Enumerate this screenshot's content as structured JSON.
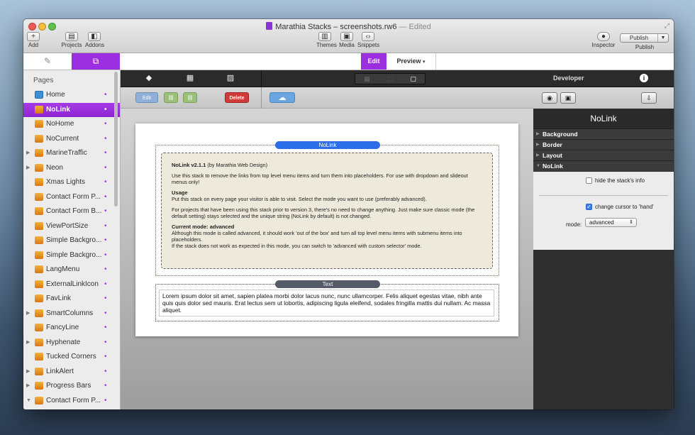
{
  "window": {
    "title": "Marathia Stacks – screenshots.rw6",
    "edited": "— Edited",
    "colors": {
      "accent": "#9b2fe0",
      "link_blue": "#3070e0",
      "delete_red": "#d23a3a"
    }
  },
  "toolbar": {
    "add": "Add",
    "projects": "Projects",
    "addons": "Addons",
    "themes": "Themes",
    "media": "Media",
    "snippets": "Snippets",
    "inspector": "Inspector",
    "publish_btn": "Publish",
    "publish": "Publish"
  },
  "tabs": {
    "edit": "Edit",
    "preview": "Preview"
  },
  "sidebar": {
    "header": "Pages",
    "items": [
      {
        "label": "Home",
        "icon": "home-icon"
      },
      {
        "label": "NoLink",
        "selected": true
      },
      {
        "label": "NoHome"
      },
      {
        "label": "NoCurrent"
      },
      {
        "label": "MarineTraffic",
        "expandable": true
      },
      {
        "label": "Neon",
        "expandable": true
      },
      {
        "label": "Xmas Lights"
      },
      {
        "label": "Contact Form P..."
      },
      {
        "label": "Contact Form B..."
      },
      {
        "label": "ViewPortSize"
      },
      {
        "label": "Simple Backgro..."
      },
      {
        "label": "Simple Backgro..."
      },
      {
        "label": "LangMenu"
      },
      {
        "label": "ExternalLinkIcon"
      },
      {
        "label": "FavLink"
      },
      {
        "label": "SmartColumns",
        "expandable": true
      },
      {
        "label": "FancyLine"
      },
      {
        "label": "Hyphenate",
        "expandable": true
      },
      {
        "label": "Tucked Corners"
      },
      {
        "label": "LinkAlert",
        "expandable": true
      },
      {
        "label": "Progress Bars",
        "expandable": true
      },
      {
        "label": "Contact Form P...",
        "expandable": true,
        "expanded": true
      }
    ]
  },
  "editor": {
    "edit_btn": "Edit",
    "delete_btn": "Delete",
    "stack1_title": "NoLink",
    "stack2_title": "Text",
    "info": {
      "heading": "NoLink v2.1.1",
      "byline": "(by Marathia Web Design)",
      "intro": "Use this stack to remove the links from top level menu items and turn them into placeholders. For use with dropdown and slideout menus only!",
      "usage_title": "Usage",
      "usage": "Put this stack on every page your visitor is able to visit. Select the mode you want to use (preferably advanced).",
      "prior": "For projects that have been using this stack prior to version 3, there's no need to change anything. Just make sure classic mode (the default setting) stays selected and the unique string (NoLink by default) is not changed.",
      "mode_title": "Current mode: advanced",
      "mode_desc": "Although this mode is called advanced, it should work 'out of the box' and turn all top level menu items with submenu items into placeholders.",
      "mode_note": "If the stack does not work as expected in this mode, you can switch to 'advanced with custom selector' mode."
    },
    "lorem": "Lorem ipsum dolor sit amet, sapien platea morbi dolor lacus nunc, nunc ullamcorper. Felis aliquet egestas vitae, nibh ante quis quis dolor sed mauris. Erat lectus sem ut lobortis, adipiscing ligula eleifend, sodales fringilla mattis dui nullam. Ac massa aliquet."
  },
  "inspector": {
    "tab": "Developer",
    "title": "NoLink",
    "sections": [
      "Background",
      "Border",
      "Layout",
      "NoLink"
    ],
    "hide_info": "hide the stack's info",
    "hide_info_checked": false,
    "cursor_hand": "change cursor to 'hand'",
    "cursor_hand_checked": true,
    "mode_label": "mode:",
    "mode_value": "advanced"
  }
}
